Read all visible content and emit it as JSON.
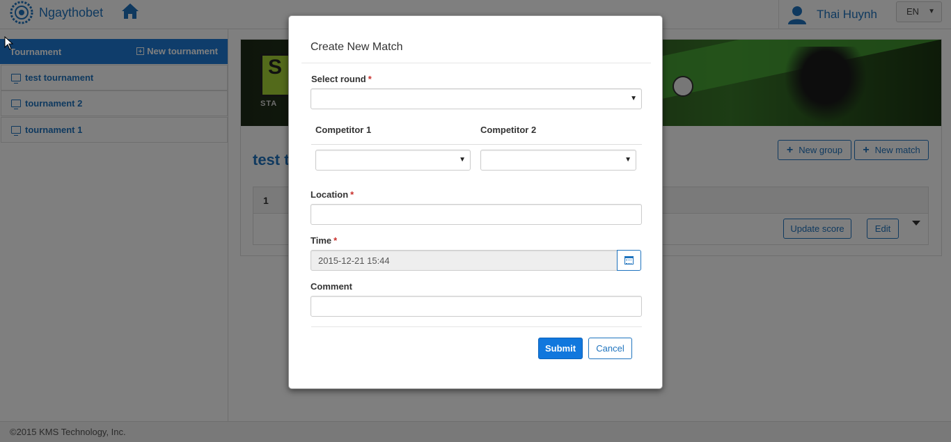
{
  "app": {
    "brand": "Ngaythobet",
    "user_name": "Thai Huynh",
    "language": "EN"
  },
  "sidebar": {
    "title": "Tournament",
    "new_tournament_label": "New tournament",
    "items": [
      {
        "label": "test tournament"
      },
      {
        "label": "tournament 2"
      },
      {
        "label": "tournament 1"
      }
    ]
  },
  "main": {
    "banner_text": "S",
    "banner_subtext": "STA",
    "page_title": "test t",
    "new_group_label": "New group",
    "new_match_label": "New match",
    "group_number": "1",
    "update_score_label": "Update score",
    "edit_label": "Edit"
  },
  "modal": {
    "title": "Create New Match",
    "select_round_label": "Select round",
    "select_round_value": "",
    "competitor1_label": "Competitor 1",
    "competitor2_label": "Competitor 2",
    "competitor1_value": "",
    "competitor2_value": "",
    "location_label": "Location",
    "location_value": "",
    "time_label": "Time",
    "time_value": "2015-12-21 15:44",
    "comment_label": "Comment",
    "comment_value": "",
    "required_mark": "*",
    "submit_label": "Submit",
    "cancel_label": "Cancel"
  },
  "footer": {
    "copyright": "©2015 KMS Technology, Inc."
  },
  "colors": {
    "primary": "#1e73be",
    "submit": "#1177dd",
    "required": "#c9302c",
    "overlay": "rgba(0,0,0,0.5)"
  }
}
